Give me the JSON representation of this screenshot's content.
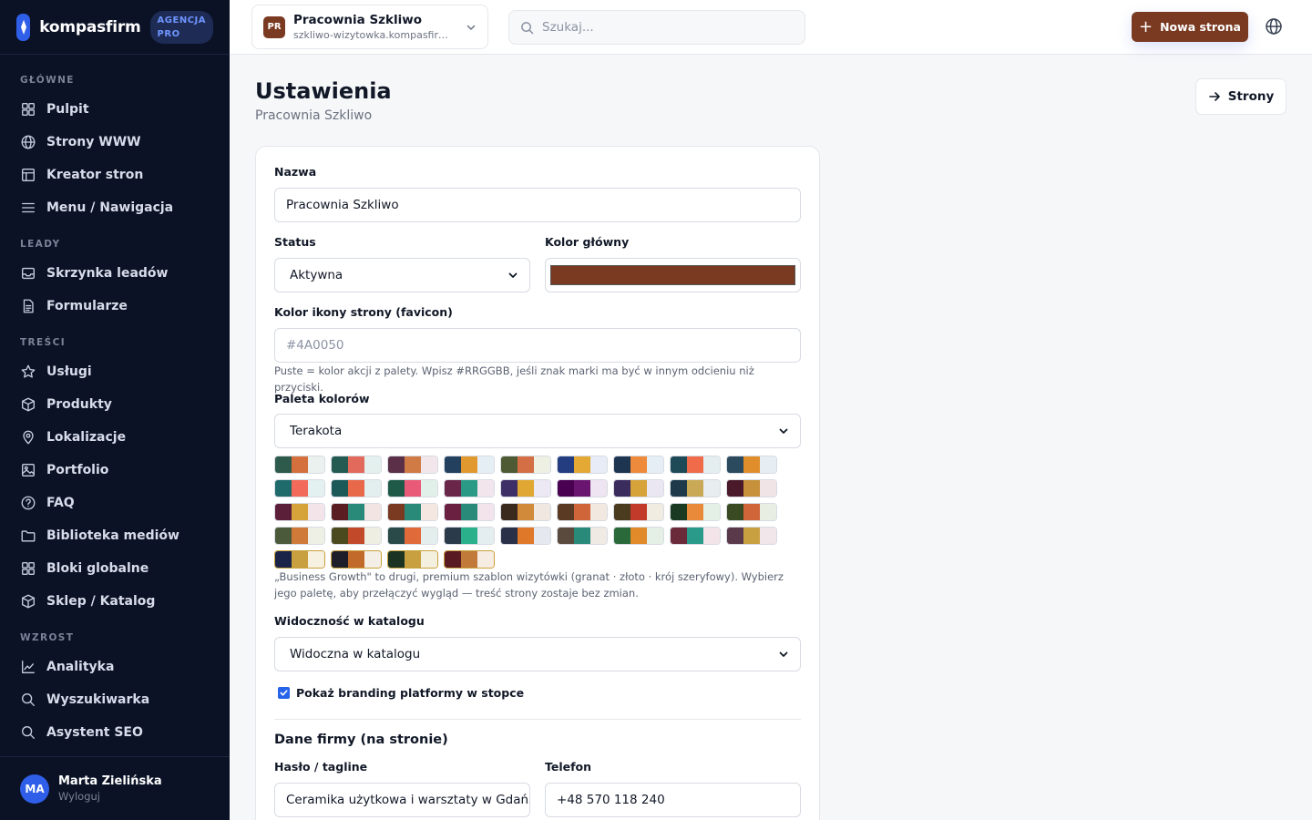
{
  "brand": {
    "name": "kompasfirm",
    "badge_line1": "AGENCJA",
    "badge_line2": "PRO"
  },
  "sidebar": {
    "sections": [
      {
        "title": "GŁÓWNE",
        "items": [
          {
            "label": "Pulpit",
            "icon": "grid-icon"
          },
          {
            "label": "Strony WWW",
            "icon": "globe-icon"
          },
          {
            "label": "Kreator stron",
            "icon": "layout-icon"
          },
          {
            "label": "Menu / Nawigacja",
            "icon": "menu-icon"
          }
        ]
      },
      {
        "title": "LEADY",
        "items": [
          {
            "label": "Skrzynka leadów",
            "icon": "inbox-icon"
          },
          {
            "label": "Formularze",
            "icon": "file-icon"
          }
        ]
      },
      {
        "title": "TREŚCI",
        "items": [
          {
            "label": "Usługi",
            "icon": "star-icon"
          },
          {
            "label": "Produkty",
            "icon": "box-icon"
          },
          {
            "label": "Lokalizacje",
            "icon": "pin-icon"
          },
          {
            "label": "Portfolio",
            "icon": "image-icon"
          },
          {
            "label": "FAQ",
            "icon": "help-icon"
          },
          {
            "label": "Biblioteka mediów",
            "icon": "folder-icon"
          },
          {
            "label": "Bloki globalne",
            "icon": "grid-icon"
          },
          {
            "label": "Sklep / Katalog",
            "icon": "box-icon"
          }
        ]
      },
      {
        "title": "WZROST",
        "items": [
          {
            "label": "Analityka",
            "icon": "chart-icon"
          },
          {
            "label": "Wyszukiwarka",
            "icon": "search-icon"
          },
          {
            "label": "Asystent SEO",
            "icon": "search-icon"
          }
        ]
      }
    ]
  },
  "user": {
    "initials": "MA",
    "name": "Marta Zielińska",
    "logout": "Wyloguj"
  },
  "topbar": {
    "site_initials": "PR",
    "site_title": "Pracownia Szkliwo",
    "site_url": "szkliwo-wizytowka.kompasfirm.pl",
    "search_placeholder": "Szukaj...",
    "new_page": "Nowa strona"
  },
  "header": {
    "title": "Ustawienia",
    "subtitle": "Pracownia Szkliwo",
    "pages_button": "Strony"
  },
  "form": {
    "name_label": "Nazwa",
    "name_value": "Pracownia Szkliwo",
    "status_label": "Status",
    "status_value": "Aktywna",
    "main_color_label": "Kolor główny",
    "main_color_value": "#7a3a22",
    "favicon_label": "Kolor ikony strony (favicon)",
    "favicon_placeholder": "#4A0050",
    "favicon_hint": "Puste = kolor akcji z palety. Wpisz #RRGGBB, jeśli znak marki ma być w innym odcieniu niż przyciski.",
    "palette_label": "Paleta kolorów",
    "palette_value": "Terakota",
    "palette_hint": "„Business Growth\" to drugi, premium szablon wizytówki (granat · złoto · krój szeryfowy). Wybierz jego paletę, aby przełączyć wygląd — treść strony zostaje bez zmian.",
    "visibility_label": "Widoczność w katalogu",
    "visibility_value": "Widoczna w katalogu",
    "branding_label": "Pokaż branding platformy w stopce",
    "company_section": "Dane firmy (na stronie)",
    "tagline_label": "Hasło / tagline",
    "tagline_value": "Ceramika użytkowa i warsztaty w Gdańsku",
    "phone_label": "Telefon",
    "phone_value": "+48 570 118 240"
  },
  "palettes": [
    [
      "#2d5a4a",
      "#d4703d",
      "#eaf1ee"
    ],
    [
      "#235a52",
      "#e26a5c",
      "#e4f0ee"
    ],
    [
      "#5b2f48",
      "#d07a45",
      "#f3e6ea"
    ],
    [
      "#23405e",
      "#e0982f",
      "#e6eef5"
    ],
    [
      "#4e5a33",
      "#d36e45",
      "#eef0e4"
    ],
    [
      "#243d80",
      "#e4a834",
      "#e7ecf7"
    ],
    [
      "#1d3550",
      "#ee8a3b",
      "#e5edf5"
    ],
    [
      "#1e4a58",
      "#f06b4a",
      "#e4eef1"
    ],
    [
      "#2b4a5e",
      "#e08e2c",
      "#e7eef3"
    ],
    [
      "#1f6a6a",
      "#f26a5a",
      "#e3f1f0"
    ],
    [
      "#1c5a5a",
      "#e8684a",
      "#e2efee"
    ],
    [
      "#1f5a48",
      "#e85a78",
      "#e2f0ea"
    ],
    [
      "#6a2648",
      "#2a9a86",
      "#f2e6ec"
    ],
    [
      "#3e2f66",
      "#e0a832",
      "#ece8f4"
    ],
    [
      "#4a0050",
      "#6a1570",
      "#efe4f1"
    ],
    [
      "#3a2d5e",
      "#d6a23a",
      "#ebe7f2"
    ],
    [
      "#1e3a4a",
      "#c9a856",
      "#e8edf0"
    ],
    [
      "#4a1a2a",
      "#c7903a",
      "#f1e4e7"
    ],
    [
      "#5c1f3a",
      "#d6a23a",
      "#f3e4ea"
    ],
    [
      "#5a1e22",
      "#2a8a7a",
      "#f3e4e4"
    ],
    [
      "#7a3a22",
      "#2a8a7a",
      "#f4e6e0"
    ],
    [
      "#6a2040",
      "#2a8a7a",
      "#f2e4ea"
    ],
    [
      "#3a2a1e",
      "#d08a3a",
      "#f0e8e0"
    ],
    [
      "#5a3a22",
      "#d0653a",
      "#f2e8e0"
    ],
    [
      "#4a3a1e",
      "#c23a2a",
      "#f0ece2"
    ],
    [
      "#1a3a22",
      "#e88a3a",
      "#e4f0e6"
    ],
    [
      "#3a4a22",
      "#d0653a",
      "#e8eee2"
    ],
    [
      "#4a5a3a",
      "#d07a3a",
      "#eef0e6"
    ],
    [
      "#4a4a1e",
      "#c24a2a",
      "#eeeee2"
    ],
    [
      "#2a4a4a",
      "#e06a3a",
      "#e4eeec"
    ],
    [
      "#2a3a4a",
      "#2ab08a",
      "#e4eef0"
    ],
    [
      "#2a3048",
      "#e0782a",
      "#e6e8f0"
    ],
    [
      "#5a4a3e",
      "#2a8a7a",
      "#efeae4"
    ],
    [
      "#2a6a3a",
      "#e08a2a",
      "#e4f0e6"
    ],
    [
      "#6a2a3a",
      "#2a9a8a",
      "#f2e4e8"
    ],
    [
      "#5a3a4a",
      "#c9a040",
      "#f1e6ea"
    ],
    [
      "#1a2348",
      "#c9a040",
      "#f7f1e2"
    ],
    [
      "#1e1e2a",
      "#c26a2a",
      "#f4efe6"
    ],
    [
      "#1a3322",
      "#c9a040",
      "#f4f0e0"
    ],
    [
      "#5a1a22",
      "#c27a3a",
      "#f6ece2"
    ]
  ]
}
